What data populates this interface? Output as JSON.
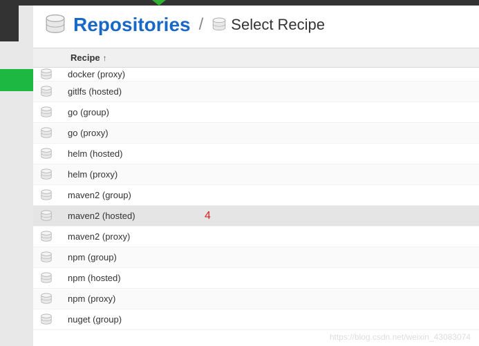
{
  "header": {
    "title": "Repositories",
    "subtitle": "Select Recipe"
  },
  "table": {
    "column_label": "Recipe",
    "rows": [
      {
        "label": "docker (proxy)",
        "highlighted": false
      },
      {
        "label": "gitlfs (hosted)",
        "highlighted": false
      },
      {
        "label": "go (group)",
        "highlighted": false
      },
      {
        "label": "go (proxy)",
        "highlighted": false
      },
      {
        "label": "helm (hosted)",
        "highlighted": false
      },
      {
        "label": "helm (proxy)",
        "highlighted": false
      },
      {
        "label": "maven2 (group)",
        "highlighted": false
      },
      {
        "label": "maven2 (hosted)",
        "highlighted": true,
        "annotation": "4"
      },
      {
        "label": "maven2 (proxy)",
        "highlighted": false
      },
      {
        "label": "npm (group)",
        "highlighted": false
      },
      {
        "label": "npm (hosted)",
        "highlighted": false
      },
      {
        "label": "npm (proxy)",
        "highlighted": false
      },
      {
        "label": "nuget (group)",
        "highlighted": false
      }
    ]
  },
  "watermark": "https://blog.csdn.net/weixin_43083074"
}
